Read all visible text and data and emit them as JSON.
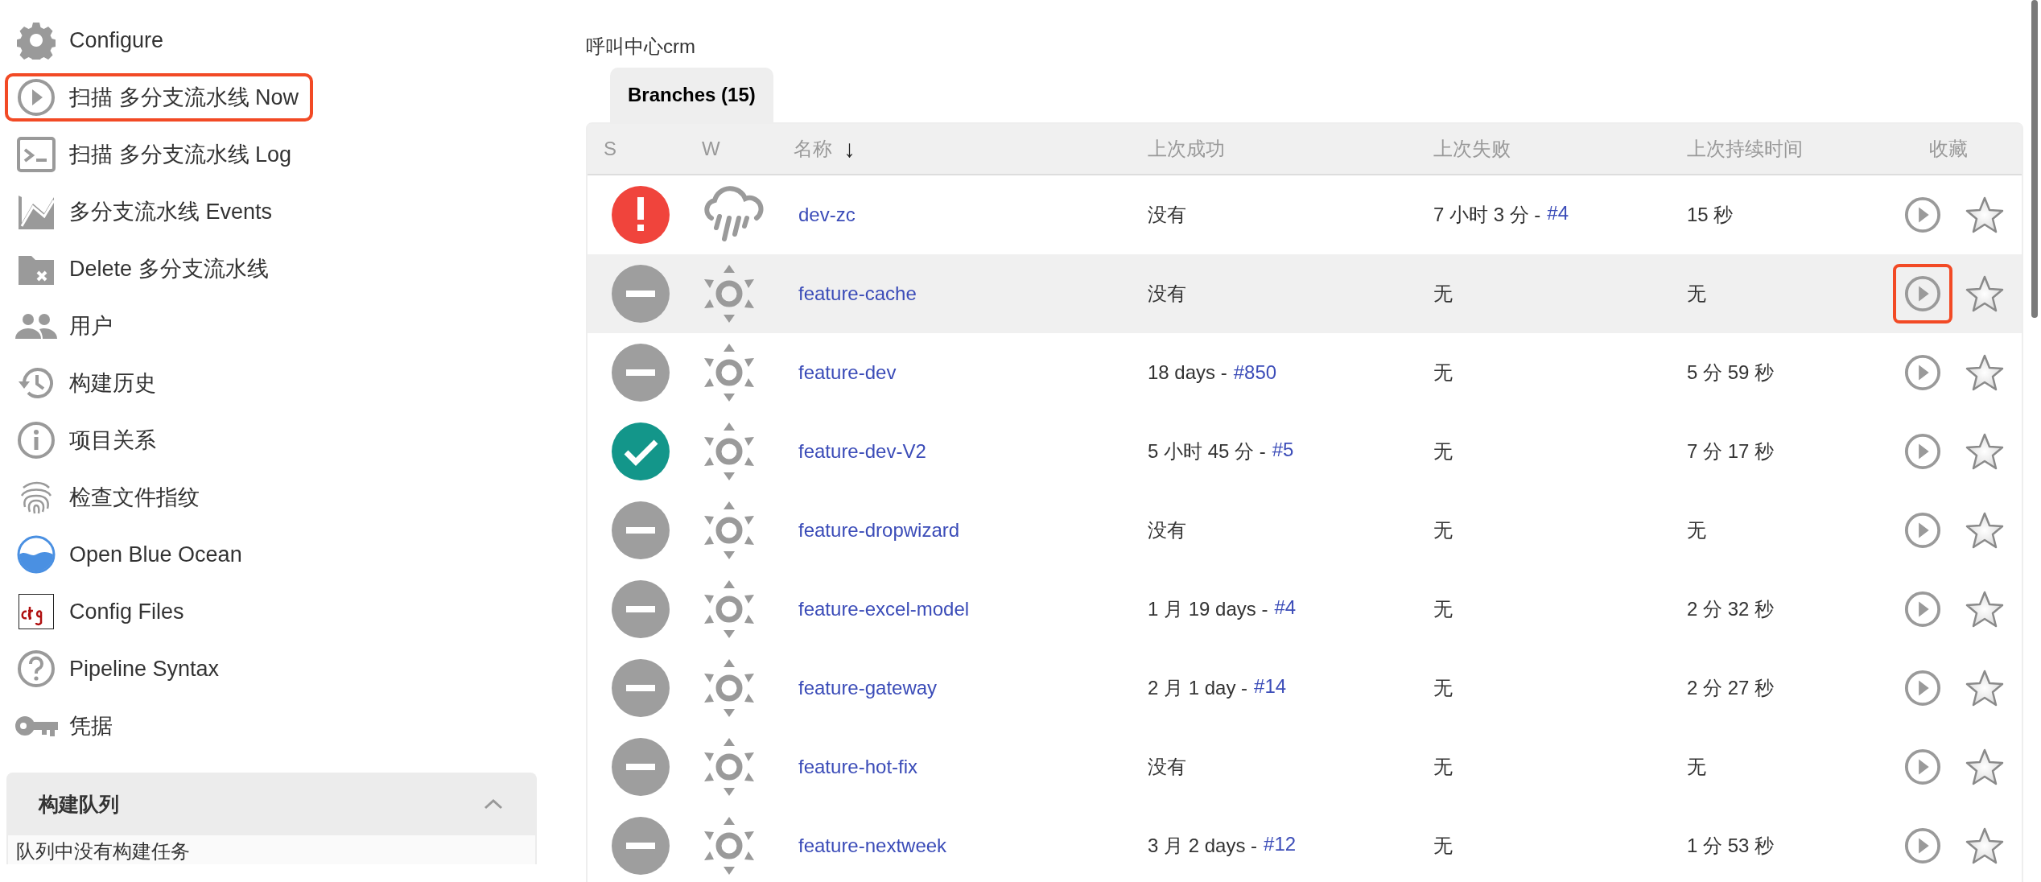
{
  "sidebar": {
    "items": [
      {
        "label": "Configure",
        "highlighted": false
      },
      {
        "label": "扫描 多分支流水线 Now",
        "highlighted": true
      },
      {
        "label": "扫描 多分支流水线 Log",
        "highlighted": false
      },
      {
        "label": "多分支流水线 Events",
        "highlighted": false
      },
      {
        "label": "Delete 多分支流水线",
        "highlighted": false
      },
      {
        "label": "用户",
        "highlighted": false
      },
      {
        "label": "构建历史",
        "highlighted": false
      },
      {
        "label": "项目关系",
        "highlighted": false
      },
      {
        "label": "检查文件指纹",
        "highlighted": false
      },
      {
        "label": "Open Blue Ocean",
        "highlighted": false
      },
      {
        "label": "Config Files",
        "highlighted": false
      },
      {
        "label": "Pipeline Syntax",
        "highlighted": false
      },
      {
        "label": "凭据",
        "highlighted": false
      }
    ]
  },
  "build_queue": {
    "title": "构建队列",
    "expanded": true,
    "message": "队列中没有构建任务"
  },
  "project_title": "呼叫中心crm",
  "tabs": [
    {
      "label": "Branches (15)",
      "selected": true
    }
  ],
  "table": {
    "columns": [
      "S",
      "W",
      "名称",
      "上次成功",
      "上次失败",
      "上次持续时间",
      "收藏"
    ],
    "sort_arrow": "↓",
    "rows": [
      {
        "kind": "failed",
        "weather": {
          "kind": "rain"
        },
        "name": "dev-zc",
        "last_success": {
          "text": "没有"
        },
        "last_failure": {
          "text": "7 小时 3 分 -",
          "build": "#4"
        },
        "duration": "15 秒",
        "hovered": false,
        "run_highlighted": false
      },
      {
        "kind": "disabled",
        "weather": {
          "kind": "sunny"
        },
        "name": "feature-cache",
        "last_success": {
          "text": "没有"
        },
        "last_failure": {
          "text": "无"
        },
        "duration": "无",
        "hovered": true,
        "run_highlighted": true
      },
      {
        "kind": "disabled",
        "weather": {
          "kind": "sunny"
        },
        "name": "feature-dev",
        "last_success": {
          "text": "18 days -",
          "build": "#850"
        },
        "last_failure": {
          "text": "无"
        },
        "duration": "5 分 59 秒",
        "hovered": false,
        "run_highlighted": false
      },
      {
        "kind": "success",
        "weather": {
          "kind": "sunny"
        },
        "name": "feature-dev-V2",
        "last_success": {
          "text": "5 小时 45 分 -",
          "build": "#5"
        },
        "last_failure": {
          "text": "无"
        },
        "duration": "7 分 17 秒",
        "hovered": false,
        "run_highlighted": false
      },
      {
        "kind": "disabled",
        "weather": {
          "kind": "sunny"
        },
        "name": "feature-dropwizard",
        "last_success": {
          "text": "没有"
        },
        "last_failure": {
          "text": "无"
        },
        "duration": "无",
        "hovered": false,
        "run_highlighted": false
      },
      {
        "kind": "disabled",
        "weather": {
          "kind": "sunny"
        },
        "name": "feature-excel-model",
        "last_success": {
          "text": "1 月 19 days -",
          "build": "#4"
        },
        "last_failure": {
          "text": "无"
        },
        "duration": "2 分 32 秒",
        "hovered": false,
        "run_highlighted": false
      },
      {
        "kind": "disabled",
        "weather": {
          "kind": "sunny"
        },
        "name": "feature-gateway",
        "last_success": {
          "text": "2 月 1 day -",
          "build": "#14"
        },
        "last_failure": {
          "text": "无"
        },
        "duration": "2 分 27 秒",
        "hovered": false,
        "run_highlighted": false
      },
      {
        "kind": "disabled",
        "weather": {
          "kind": "sunny"
        },
        "name": "feature-hot-fix",
        "last_success": {
          "text": "没有"
        },
        "last_failure": {
          "text": "无"
        },
        "duration": "无",
        "hovered": false,
        "run_highlighted": false
      },
      {
        "kind": "disabled",
        "weather": {
          "kind": "sunny"
        },
        "name": "feature-nextweek",
        "last_success": {
          "text": "3 月 2 days -",
          "build": "#12"
        },
        "last_failure": {
          "text": "无"
        },
        "duration": "1 分 53 秒",
        "hovered": false,
        "run_highlighted": false
      }
    ]
  }
}
